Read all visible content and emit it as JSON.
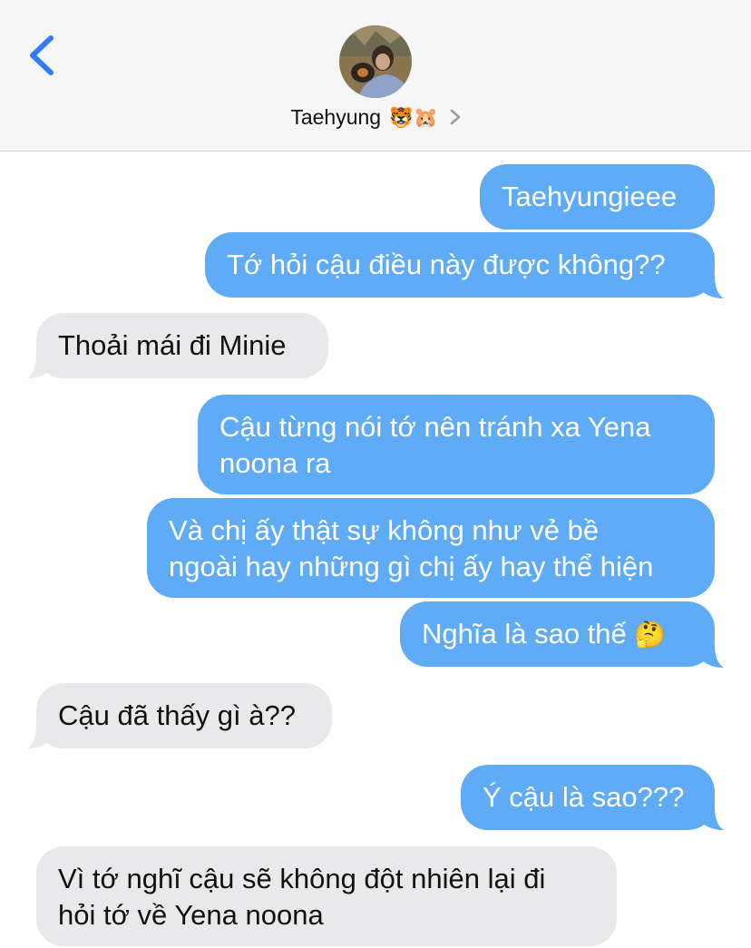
{
  "header": {
    "contact_name": "Taehyung",
    "contact_emojis": "🐯🐹"
  },
  "messages": [
    {
      "side": "out",
      "text": "Taehyungieee"
    },
    {
      "side": "out",
      "text": "Tớ hỏi cậu điều này được không??"
    },
    {
      "side": "in",
      "text": "Thoải mái đi Minie"
    },
    {
      "side": "out",
      "lines": [
        "Cậu từng nói tớ nên tránh xa Yena",
        "noona ra"
      ]
    },
    {
      "side": "out",
      "lines": [
        "Và chị ấy thật sự không như vẻ bề",
        "ngoài hay những gì chị ấy hay thể hiện"
      ]
    },
    {
      "side": "out",
      "text": "Nghĩa là sao thế",
      "emoji": "🤔"
    },
    {
      "side": "in",
      "text": "Cậu đã thấy gì à??"
    },
    {
      "side": "out",
      "text": "Ý cậu là sao???"
    },
    {
      "side": "in",
      "lines": [
        "Vì tớ nghĩ cậu sẽ không đột nhiên lại đi",
        "hỏi tớ về Yena noona"
      ]
    }
  ],
  "colors": {
    "outgoing_bubble": "#5fabf5",
    "incoming_bubble": "#e9e9eb",
    "accent": "#2f7cf6",
    "header_bg": "#f6f6f6"
  },
  "icons": {
    "back": "chevron-left-icon",
    "contact_detail": "chevron-right-icon"
  }
}
